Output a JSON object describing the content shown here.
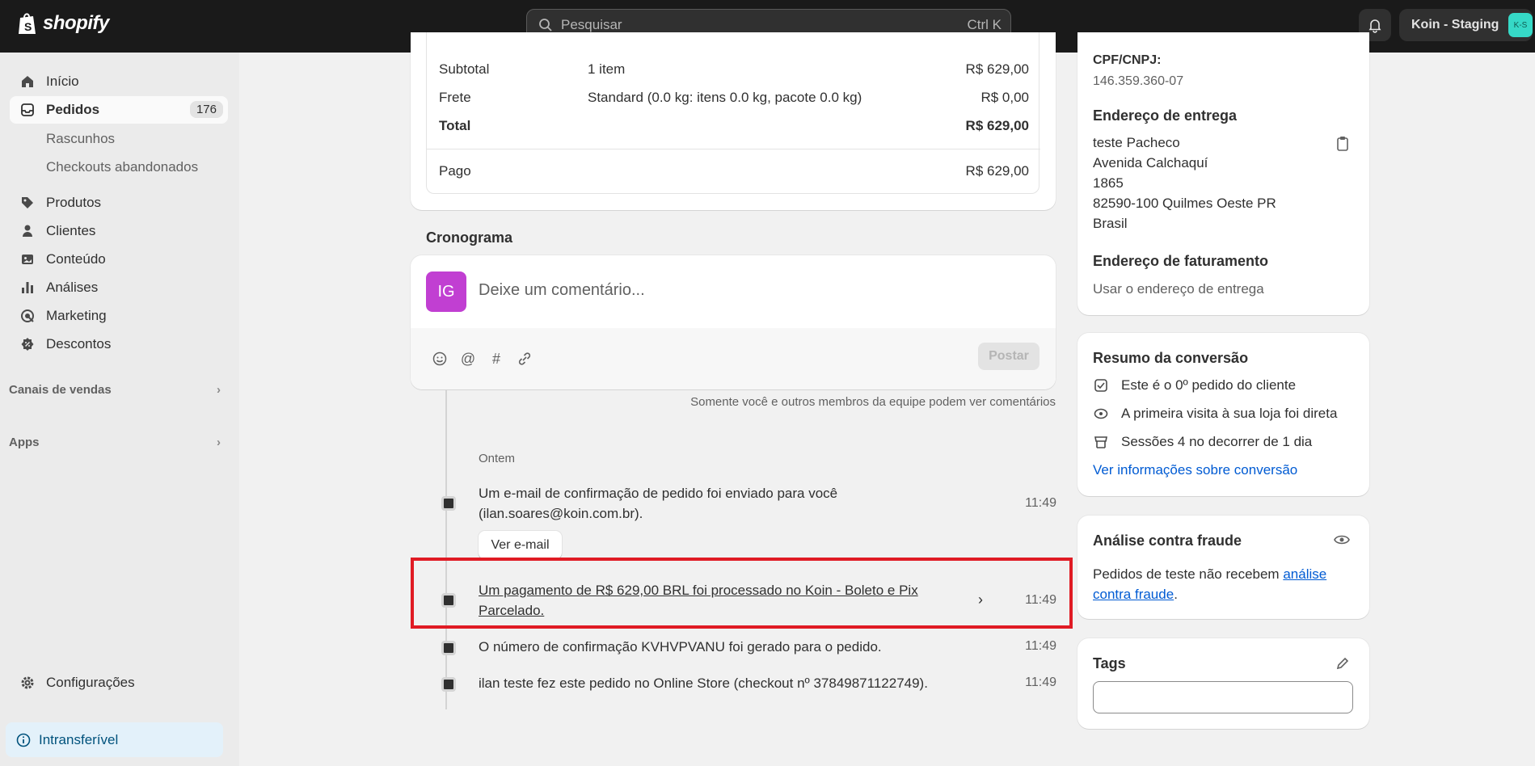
{
  "topbar": {
    "brand": "shopify",
    "search_placeholder": "Pesquisar",
    "search_shortcut": "Ctrl K",
    "store_name": "Koin - Staging",
    "store_initials": "K-S"
  },
  "sidebar": {
    "items": [
      {
        "label": "Início",
        "icon": "home-icon"
      },
      {
        "label": "Pedidos",
        "icon": "orders-icon",
        "badge": "176"
      },
      {
        "label": "Produtos",
        "icon": "tag-icon"
      },
      {
        "label": "Clientes",
        "icon": "person-icon"
      },
      {
        "label": "Conteúdo",
        "icon": "content-icon"
      },
      {
        "label": "Análises",
        "icon": "bar-chart-icon"
      },
      {
        "label": "Marketing",
        "icon": "target-icon"
      },
      {
        "label": "Descontos",
        "icon": "discount-icon"
      }
    ],
    "sub_items": [
      "Rascunhos",
      "Checkouts abandonados"
    ],
    "sections": [
      "Canais de vendas",
      "Apps"
    ],
    "settings": "Configurações",
    "nontransferable": "Intransferível"
  },
  "summary": {
    "rows": [
      {
        "label": "Subtotal",
        "detail": "1 item",
        "amount": "R$ 629,00"
      },
      {
        "label": "Frete",
        "detail": "Standard (0.0 kg: itens 0.0 kg, pacote 0.0 kg)",
        "amount": "R$ 0,00"
      },
      {
        "label": "Total",
        "detail": "",
        "amount": "R$ 629,00"
      },
      {
        "label": "Pago",
        "detail": "",
        "amount": "R$ 629,00"
      }
    ]
  },
  "timeline": {
    "title": "Cronograma",
    "avatar_initials": "IG",
    "comment_placeholder": "Deixe um comentário...",
    "post_label": "Postar",
    "note": "Somente você e outros membros da equipe podem ver comentários",
    "date_label": "Ontem",
    "events": [
      {
        "text_line1": "Um e-mail de confirmação de pedido foi enviado para você",
        "text_line2": "(ilan.soares@koin.com.br).",
        "time": "11:49",
        "button": "Ver e-mail"
      },
      {
        "text_line1": "Um pagamento de R$ 629,00 BRL foi processado no Koin - Boleto e Pix",
        "text_line2": "Parcelado.",
        "time": "11:49"
      },
      {
        "text_line1": "O número de confirmação KVHVPVANU foi gerado para o pedido.",
        "time": "11:49"
      },
      {
        "text_line1": "ilan teste fez este pedido no Online Store (checkout nº 37849871122749).",
        "time": "11:49"
      }
    ]
  },
  "customer": {
    "cpf_label": "CPF/CNPJ:",
    "cpf_value": "146.359.360-07",
    "shipping_title": "Endereço de entrega",
    "shipping_lines": [
      "teste Pacheco",
      "Avenida Calchaquí",
      "1865",
      "82590-100 Quilmes Oeste PR",
      "Brasil"
    ],
    "billing_title": "Endereço de faturamento",
    "billing_text": "Usar o endereço de entrega"
  },
  "conversion": {
    "title": "Resumo da conversão",
    "rows": [
      "Este é o 0º pedido do cliente",
      "A primeira visita à sua loja foi direta",
      "Sessões 4 no decorrer de 1 dia"
    ],
    "link": "Ver informações sobre conversão"
  },
  "fraud": {
    "title": "Análise contra fraude",
    "text": "Pedidos de teste não recebem ",
    "link": "análise contra fraude",
    "suffix": "."
  },
  "tags": {
    "title": "Tags",
    "value": ""
  }
}
